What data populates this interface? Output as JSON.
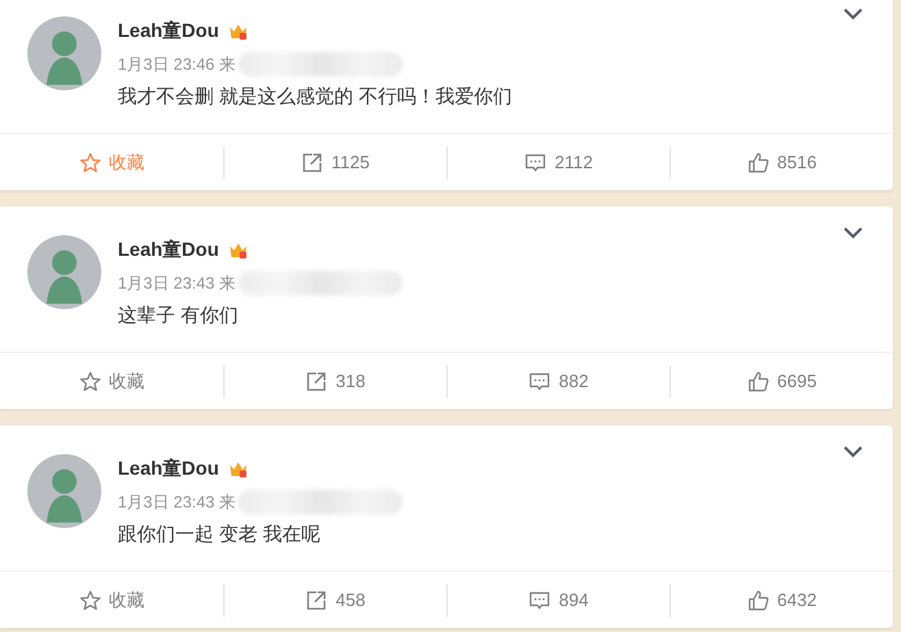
{
  "posts": [
    {
      "author": "Leah童Dou",
      "time": "1月3日 23:46",
      "source_prefix": "来",
      "text": "我才不会删 就是这么感觉的 不行吗！我爱你们",
      "favorited": true,
      "favorite_label": "收藏",
      "reposts": "1125",
      "comments": "2112",
      "likes": "8516"
    },
    {
      "author": "Leah童Dou",
      "time": "1月3日 23:43",
      "source_prefix": "来",
      "text": "这辈子 有你们",
      "favorited": false,
      "favorite_label": "收藏",
      "reposts": "318",
      "comments": "882",
      "likes": "6695"
    },
    {
      "author": "Leah童Dou",
      "time": "1月3日 23:43",
      "source_prefix": "来",
      "text": "跟你们一起 变老 我在呢",
      "favorited": false,
      "favorite_label": "收藏",
      "reposts": "458",
      "comments": "894",
      "likes": "6432"
    }
  ]
}
